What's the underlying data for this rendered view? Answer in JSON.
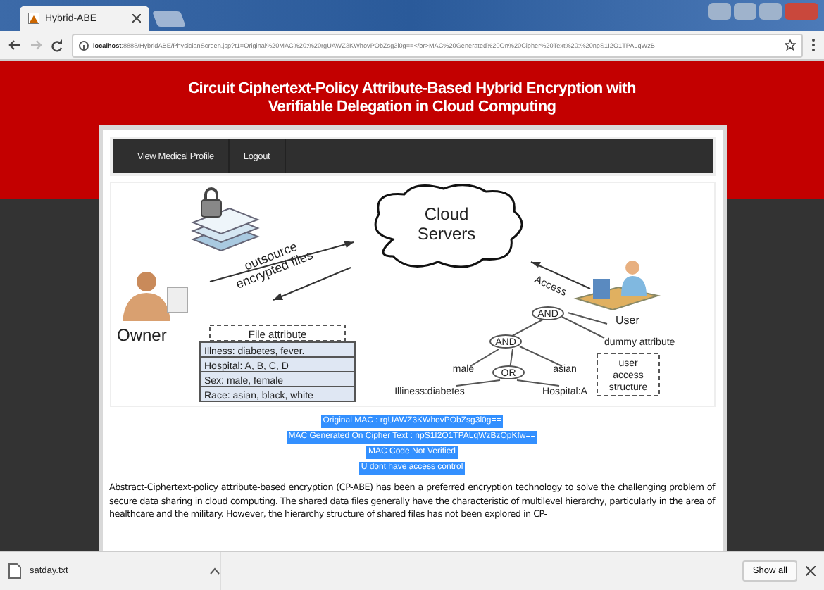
{
  "browser": {
    "tab": {
      "title": "Hybrid-ABE",
      "selected": true
    },
    "url": "**localhost**:8888/HybridABE/PhysicianScreen.jsp?t1=Original%20MAC%20:%20rgUAWZ3KWhovPObZsg3l0g==</br>MAC%20Generated%20On%20Cipher%20Text%20:%20npS1I2O1TPALqWzB"
  },
  "header": {
    "title": "Circuit Ciphertext-Policy Attribute-Based Hybrid Encryption with Verifiable Delegation in Cloud Computing"
  },
  "nav": [
    {
      "label": "View Medical Profile"
    },
    {
      "label": "Logout"
    }
  ],
  "diagram": {
    "cloud": [
      "Cloud",
      "Servers"
    ],
    "upload_label": [
      "outsource",
      "encrypted files"
    ],
    "owner": "Owner",
    "file_attribute": "File attribute",
    "attributes": [
      "Illness: diabetes, fever.",
      "Hospital: A, B, C, D",
      "Sex: male, female",
      "Race: asian, black, white"
    ],
    "access": "Access",
    "user": "User",
    "tree": [
      {
        "kind": "gate",
        "label": "AND"
      },
      {
        "kind": "gate",
        "label": "AND"
      },
      {
        "kind": "leaf",
        "label": "dummy attribute"
      },
      {
        "kind": "leaf",
        "label": "male"
      },
      {
        "kind": "gate",
        "label": "OR"
      },
      {
        "kind": "leaf",
        "label": "asian"
      },
      {
        "kind": "leaf",
        "label": "Illiness:diabetes"
      },
      {
        "kind": "leaf",
        "label": "Hospital:A"
      }
    ],
    "structure": [
      "user",
      "access",
      "structure"
    ]
  },
  "messages": [
    "Original MAC : rgUAWZ3KWhovPObZsg3l0g==",
    "MAC Generated On Cipher Text : npS1I2O1TPALqWzBzOpKfw==",
    "MAC Code Not Verified",
    "U dont have access control"
  ],
  "abstract": "Abstract-Ciphertext-policy attribute-based encryption (CP-ABE) has been a preferred encryption technology to solve the challenging problem of secure data sharing in cloud computing. The shared data files generally have the characteristic of multilevel hierarchy, particularly in the area of healthcare and the military. However, the hierarchy structure of shared files has not been explored in CP-",
  "downloads": {
    "file": "satday.txt",
    "show_all": "Show all"
  }
}
